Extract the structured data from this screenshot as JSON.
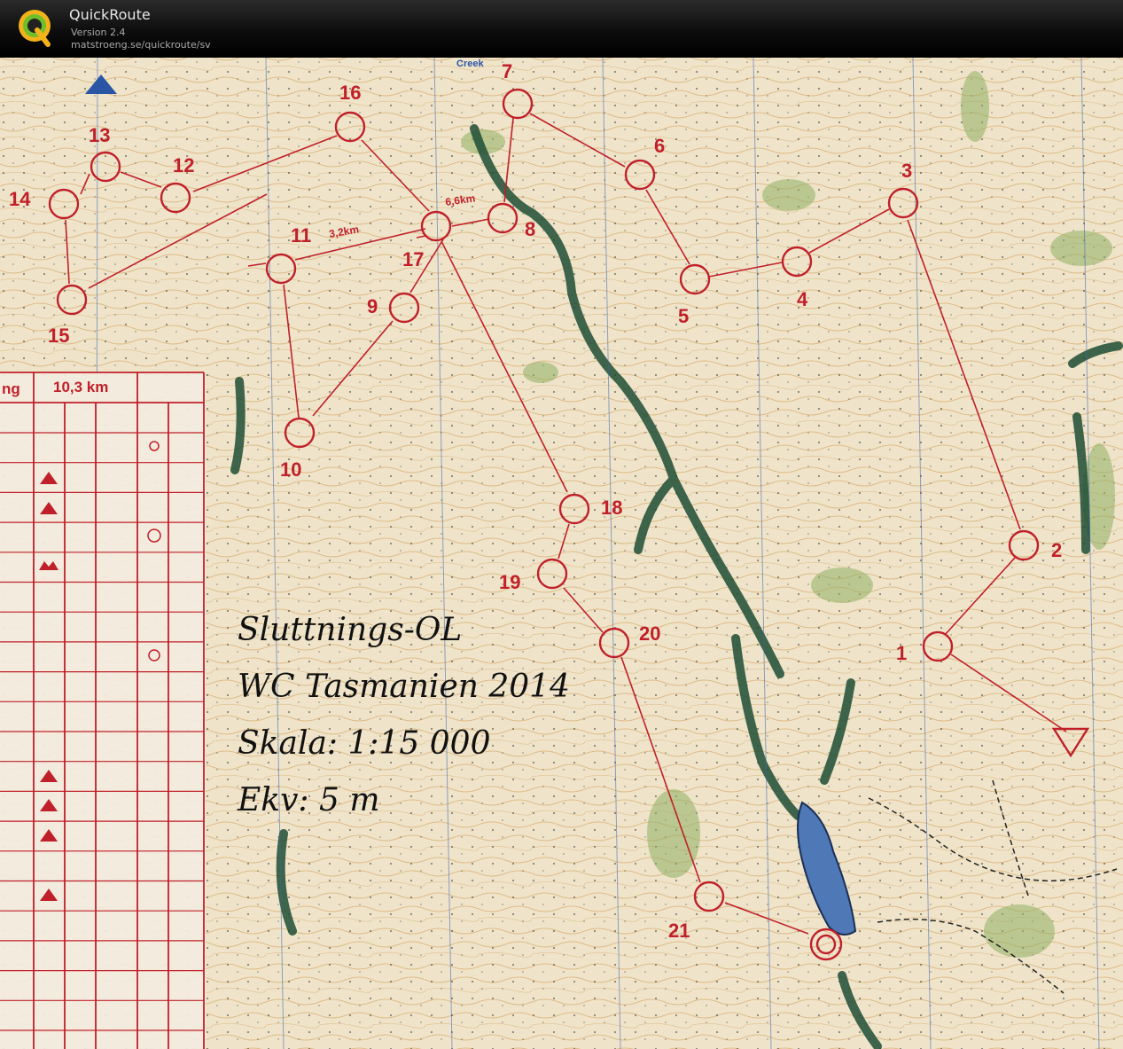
{
  "app": {
    "name": "QuickRoute",
    "version": "Version 2.4",
    "url": "matstroeng.se/quickroute/sv",
    "logo_letter": "Q"
  },
  "map": {
    "creek_label": "Creek",
    "info_lines": [
      "Sluttnings-OL",
      "WC Tasmanien 2014",
      "Skala: 1:15 000",
      "Ekv: 5 m"
    ],
    "leg_labels": [
      "6,6km",
      "3,2km"
    ],
    "course_color": "#c0202a",
    "controls": [
      {
        "n": "1"
      },
      {
        "n": "2"
      },
      {
        "n": "3"
      },
      {
        "n": "4"
      },
      {
        "n": "5"
      },
      {
        "n": "6"
      },
      {
        "n": "7"
      },
      {
        "n": "8"
      },
      {
        "n": "9"
      },
      {
        "n": "10"
      },
      {
        "n": "11"
      },
      {
        "n": "12"
      },
      {
        "n": "13"
      },
      {
        "n": "14"
      },
      {
        "n": "15"
      },
      {
        "n": "16"
      },
      {
        "n": "17"
      },
      {
        "n": "18"
      },
      {
        "n": "19"
      },
      {
        "n": "20"
      },
      {
        "n": "21"
      }
    ],
    "description_sheet": {
      "header_left": "ng",
      "header_distance": "10,3 km"
    }
  }
}
